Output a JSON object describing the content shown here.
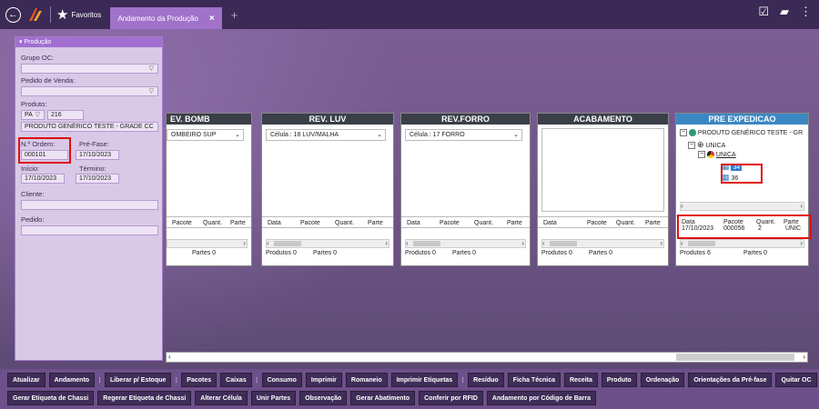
{
  "topbar": {
    "favorites_label": "Favoritos",
    "tab_label": "Andamento da Produção",
    "tab_close": "×",
    "add_tab": "+"
  },
  "left_panel": {
    "header": "Produção",
    "grupo_oc_label": "Grupo OC:",
    "grupo_oc_value": "",
    "pedido_venda_label": "Pedido de Venda:",
    "pedido_venda_value": "",
    "produto_label": "Produto:",
    "produto_type": "PA",
    "produto_code": "216",
    "produto_name": "PRODUTO GENÉRICO TESTE - GRADE CC",
    "n_ordem_label": "N.º Ordem:",
    "n_ordem_value": "000101",
    "pre_fase_label": "Pré-Fase:",
    "pre_fase_value": "17/10/2023",
    "inicio_label": "Início:",
    "inicio_value": "17/10/2023",
    "termino_label": "Término:",
    "termino_value": "17/10/2023",
    "cliente_label": "Cliente:",
    "cliente_value": "",
    "pedido_label": "Pedido:",
    "pedido_value": ""
  },
  "columns": [
    {
      "title": "EV. BOMB",
      "cell": "OMBEIRO SUP",
      "headers": [
        "Pacote",
        "Quant.",
        "Parte"
      ],
      "produtos": "",
      "partes": "Partes  0"
    },
    {
      "title": "REV. LUV",
      "cell": "Célula :  18 LUV/MALHA",
      "headers": [
        "Data",
        "Pacote",
        "Quant.",
        "Parte"
      ],
      "produtos": "Produtos  0",
      "partes": "Partes  0"
    },
    {
      "title": "REV.FORRO",
      "cell": "Célula :  17 FORRO",
      "headers": [
        "Data",
        "Pacote",
        "Quant.",
        "Parte"
      ],
      "produtos": "Produtos  0",
      "partes": "Partes  0"
    },
    {
      "title": "ACABAMENTO",
      "cell": "",
      "headers": [
        "Data",
        "Pacote",
        "Quant.",
        "Parte"
      ],
      "produtos": "Produtos  0",
      "partes": "Partes  0"
    },
    {
      "title": "PRE EXPEDICAO",
      "cell": "",
      "headers": [
        "Data",
        "Pacote",
        "Quant.",
        "Parte"
      ],
      "produtos": "Produtos  6",
      "partes": "Partes  0"
    }
  ],
  "pre_expedicao": {
    "tree": {
      "product": "PRODUTO GENÉRICO TESTE - GR",
      "unica1": "UNICA",
      "unica2": "UNICA",
      "item_selected": "34",
      "item2": "36"
    },
    "row": {
      "data": "17/10/2023",
      "pacote": "000056",
      "quant": "2",
      "parte": "ÚNIC"
    }
  },
  "toolbar_row1": [
    "Atualizar",
    "Andamento",
    "Liberar p/ Estoque",
    "Pacotes",
    "Caixas",
    "Consumo",
    "Imprimir",
    "Romaneio",
    "Imprimir Etiquetas",
    "Resíduo",
    "Ficha Técnica",
    "Receita",
    "Produto",
    "Ordenação",
    "Orientações da Pré-fase",
    "Quitar OC"
  ],
  "toolbar_row2": [
    "Gerar Etiqueta de Chassi",
    "Regerar Etiqueta de Chassi",
    "Alterar Célula",
    "Unir Partes",
    "Observação",
    "Gerar Abatimento",
    "Conferir por RFID",
    "Andamento por Código de Barra"
  ],
  "colors": {
    "accent": "#a072c9",
    "header_dark": "#3a3f48",
    "header_blue": "#3b87c4",
    "highlight": "#e01010"
  }
}
